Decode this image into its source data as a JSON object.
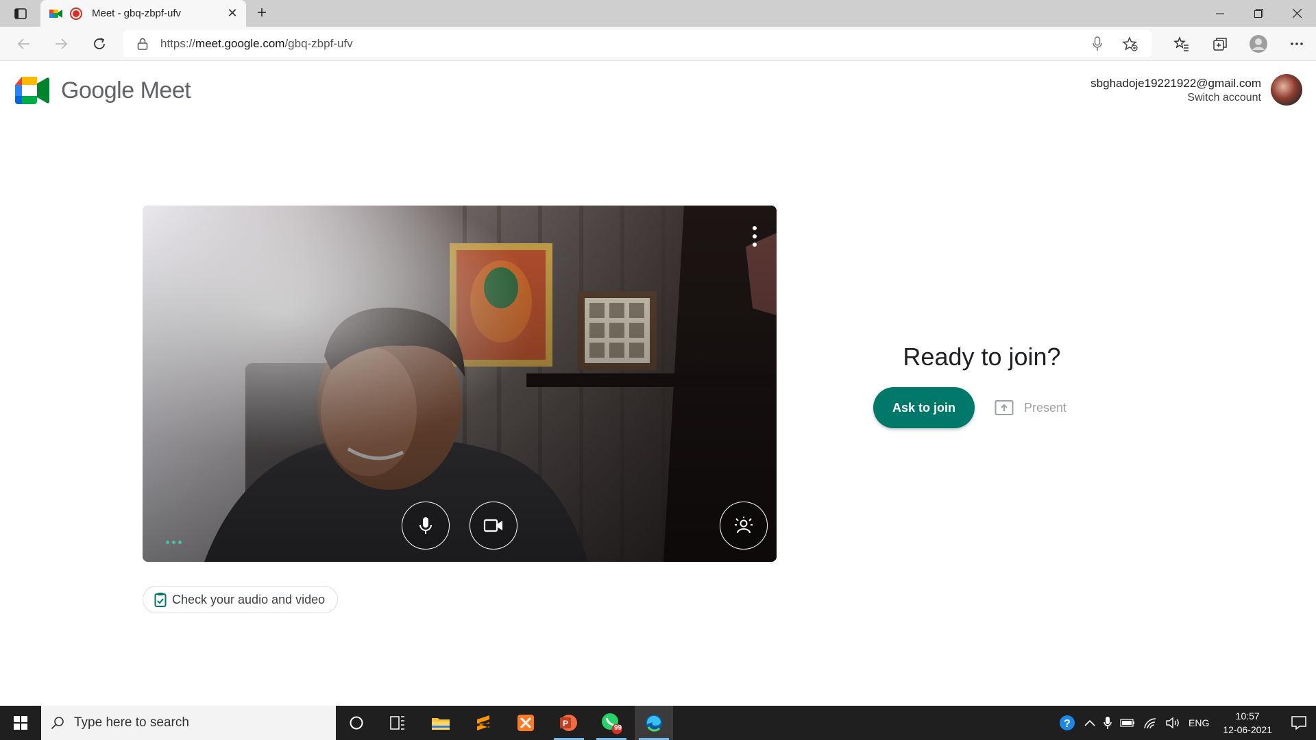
{
  "browser": {
    "tab_title": "Meet - gbq-zbpf-ufv",
    "url_prefix": "https://",
    "url_host": "meet.google.com",
    "url_path": "/gbq-zbpf-ufv",
    "new_tab_label": "+",
    "close_tab_label": "✕"
  },
  "meet": {
    "logo_text": "Google Meet",
    "account_email": "sbghadoje19221922@gmail.com",
    "switch_account": "Switch account",
    "check_audio_video": "Check your audio and video",
    "ready_title": "Ready to join?",
    "ask_to_join": "Ask to join",
    "present": "Present"
  },
  "taskbar": {
    "search_placeholder": "Type here to search",
    "language": "ENG",
    "time": "10:57",
    "date": "12-06-2021",
    "whatsapp_badge": "99"
  },
  "colors": {
    "accent_green": "#00796b",
    "recording_red": "#d93025"
  },
  "icons": [
    "tab-actions-icon",
    "meet-favicon",
    "recording-icon",
    "close-icon",
    "back-icon",
    "forward-icon",
    "refresh-icon",
    "lock-icon",
    "mic-icon",
    "add-favorite-icon",
    "favorites-icon",
    "collections-icon",
    "profile-icon",
    "more-icon",
    "camera-icon",
    "effects-icon",
    "windows-start-icon",
    "search-icon",
    "cortana-icon",
    "task-view-icon",
    "file-explorer-icon",
    "sublime-icon",
    "xampp-icon",
    "powerpoint-icon",
    "whatsapp-icon",
    "edge-icon",
    "help-icon",
    "chevron-up-icon",
    "battery-icon",
    "wifi-icon",
    "volume-icon",
    "notification-icon"
  ]
}
